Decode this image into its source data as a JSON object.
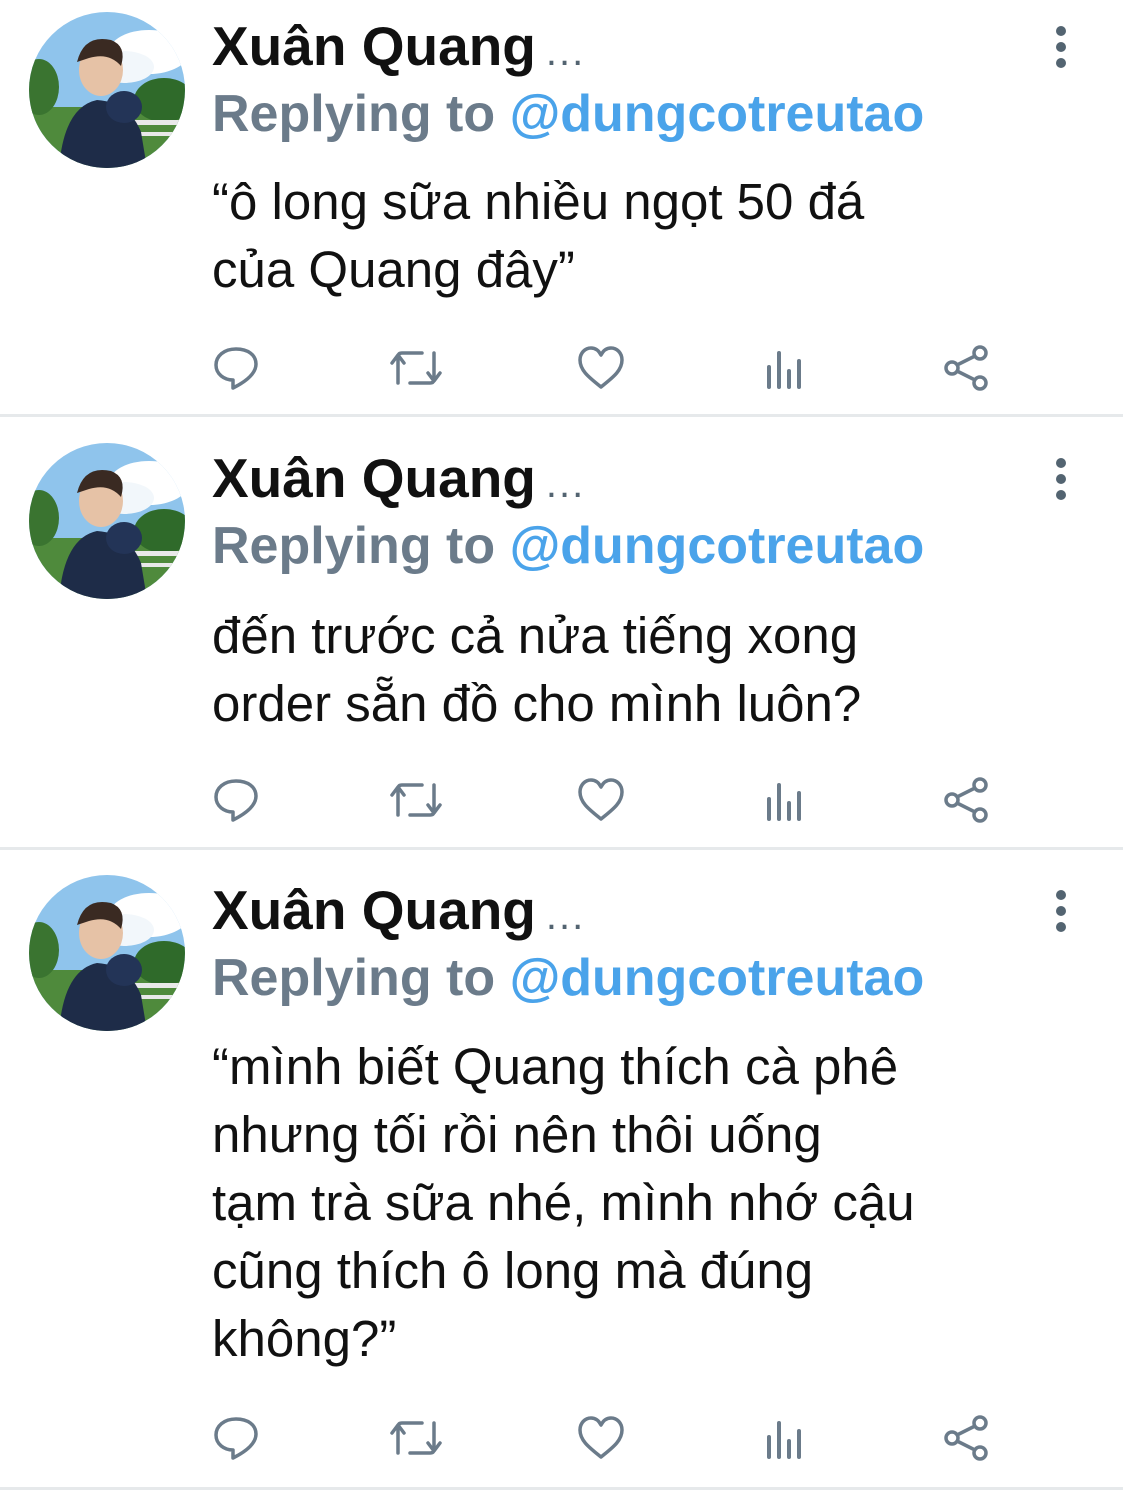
{
  "tweets": [
    {
      "name": "Xuân Quang",
      "name_suffix": "...",
      "reply_prefix": "Replying to",
      "reply_handle": "@dungcotreutao",
      "text": "“ô long sữa nhiều ngọt 50 đá\ncủa Quang đây”"
    },
    {
      "name": "Xuân Quang",
      "name_suffix": "...",
      "reply_prefix": "Replying to",
      "reply_handle": "@dungcotreutao",
      "text": "đến trước cả nửa tiếng xong\norder sẵn đồ cho mình luôn?"
    },
    {
      "name": "Xuân Quang",
      "name_suffix": "...",
      "reply_prefix": "Replying to",
      "reply_handle": "@dungcotreutao",
      "text": "“mình biết Quang thích cà phê\nnhưng tối rồi nên thôi uống\ntạm trà sữa nhé, mình nhớ cậu\ncũng thích ô long mà đúng\nkhông?”"
    }
  ],
  "icons": {
    "reply": "speech-bubble-icon",
    "retweet": "retweet-icon",
    "like": "heart-icon",
    "analytics": "bar-chart-icon",
    "share": "share-icon",
    "more": "vertical-dots-icon"
  },
  "colors": {
    "text": "#111111",
    "secondary": "#6b7b8a",
    "handle": "#4aa3ea",
    "icon": "#6b7b8a",
    "divider": "#e6e9eb"
  }
}
